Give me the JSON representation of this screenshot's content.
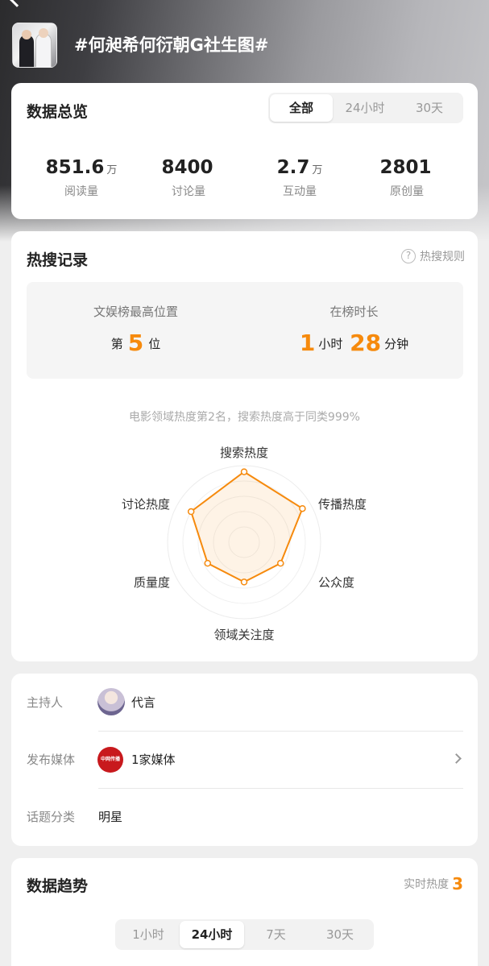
{
  "topic": {
    "title": "#何昶希何衍朝G社生图#"
  },
  "overview": {
    "title": "数据总览",
    "tabs": [
      "全部",
      "24小时",
      "30天"
    ],
    "active_tab": 0,
    "stats": [
      {
        "value": "851.6",
        "unit": "万",
        "label": "阅读量"
      },
      {
        "value": "8400",
        "unit": "",
        "label": "讨论量"
      },
      {
        "value": "2.7",
        "unit": "万",
        "label": "互动量"
      },
      {
        "value": "2801",
        "unit": "",
        "label": "原创量"
      }
    ]
  },
  "hot": {
    "title": "热搜记录",
    "rules_label": "热搜规则",
    "rules_icon": "question-circle-icon",
    "best_position": {
      "label": "文娱榜最高位置",
      "prefix": "第",
      "value": "5",
      "suffix": "位"
    },
    "duration": {
      "label": "在榜时长",
      "hours": "1",
      "hours_unit": "小时",
      "minutes": "28",
      "minutes_unit": "分钟"
    },
    "summary": "电影领域热度第2名，搜索热度高于同类999%",
    "radar": {
      "axes": [
        "搜索热度",
        "传播热度",
        "公众度",
        "领域关注度",
        "质量度",
        "讨论热度"
      ],
      "values": [
        0.92,
        0.88,
        0.55,
        0.52,
        0.55,
        0.8
      ],
      "color": "#f68a0d"
    }
  },
  "info": {
    "host_label": "主持人",
    "host_name": "代言",
    "media_label": "发布媒体",
    "media_logo_text": "中网传播",
    "media_value": "1家媒体",
    "category_label": "话题分类",
    "category_value": "明星"
  },
  "trend": {
    "title": "数据趋势",
    "live_label": "实时热度",
    "live_value": "3",
    "tabs": [
      "1小时",
      "24小时",
      "7天",
      "30天"
    ],
    "active_tab": 1
  },
  "colors": {
    "accent": "#f68a0d",
    "background": "#efefef"
  }
}
